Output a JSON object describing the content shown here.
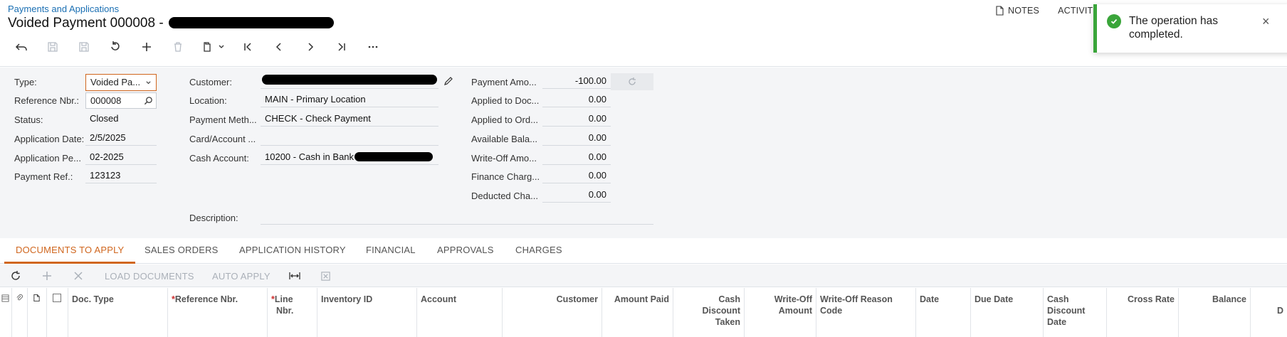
{
  "header": {
    "breadcrumb": "Payments and Applications",
    "title": "Voided Payment 000008 -",
    "notes_label": "NOTES",
    "activities_label": "ACTIVITI"
  },
  "toast": {
    "message": "The operation has completed.",
    "close": "×"
  },
  "form": {
    "type_label": "Type:",
    "type_value": "Voided Pa...",
    "ref_label": "Reference Nbr.:",
    "ref_value": "000008",
    "status_label": "Status:",
    "status_value": "Closed",
    "app_date_label": "Application Date:",
    "app_date_value": "2/5/2025",
    "app_period_label": "Application Pe...",
    "app_period_value": "02-2025",
    "payment_ref_label": "Payment Ref.:",
    "payment_ref_value": "123123",
    "customer_label": "Customer:",
    "location_label": "Location:",
    "location_value": "MAIN - Primary Location",
    "payment_method_label": "Payment Meth...",
    "payment_method_value": "CHECK - Check Payment",
    "card_account_label": "Card/Account ...",
    "cash_account_label": "Cash Account:",
    "cash_account_value": "10200 - Cash in Bank",
    "description_label": "Description:",
    "payment_amount_label": "Payment Amo...",
    "payment_amount_value": "-100.00",
    "applied_doc_label": "Applied to Doc...",
    "applied_doc_value": "0.00",
    "applied_ord_label": "Applied to Ord...",
    "applied_ord_value": "0.00",
    "available_label": "Available Bala...",
    "available_value": "0.00",
    "writeoff_label": "Write-Off Amo...",
    "writeoff_value": "0.00",
    "finance_label": "Finance Charg...",
    "finance_value": "0.00",
    "deducted_label": "Deducted Cha...",
    "deducted_value": "0.00"
  },
  "tabs": [
    "DOCUMENTS TO APPLY",
    "SALES ORDERS",
    "APPLICATION HISTORY",
    "FINANCIAL",
    "APPROVALS",
    "CHARGES"
  ],
  "grid_toolbar": {
    "load_documents": "LOAD DOCUMENTS",
    "auto_apply": "AUTO APPLY"
  },
  "grid_columns": {
    "doc_type": "Doc. Type",
    "reference_nbr": "Reference Nbr.",
    "line_nbr_1": "Line",
    "line_nbr_2": "Nbr.",
    "inventory_id": "Inventory ID",
    "account": "Account",
    "customer": "Customer",
    "amount_paid": "Amount Paid",
    "cash_discount_taken_1": "Cash",
    "cash_discount_taken_2": "Discount",
    "cash_discount_taken_3": "Taken",
    "writeoff_amount_1": "Write-Off",
    "writeoff_amount_2": "Amount",
    "writeoff_reason_1": "Write-Off Reason",
    "writeoff_reason_2": "Code",
    "date": "Date",
    "due_date": "Due Date",
    "cash_discount_date_1": "Cash",
    "cash_discount_date_2": "Discount",
    "cash_discount_date_3": "Date",
    "cross_rate": "Cross Rate",
    "balance": "Balance",
    "cut_off": "D"
  },
  "required_mark": "*"
}
